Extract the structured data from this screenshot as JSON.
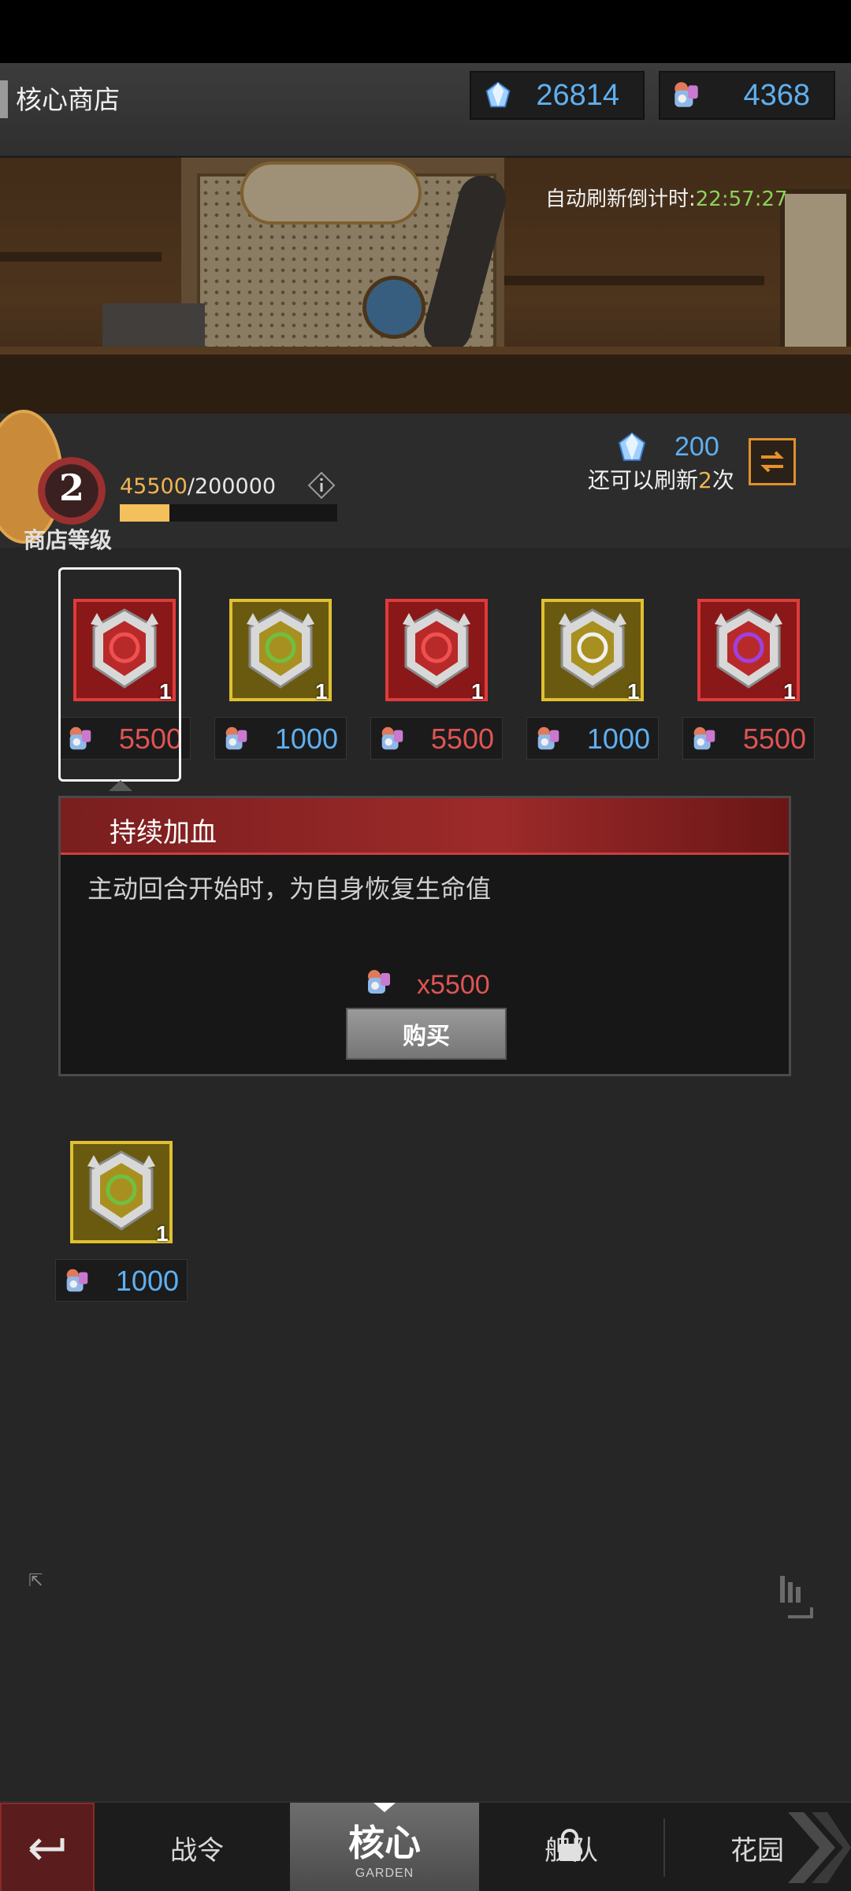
{
  "header": {
    "title": "核心商店",
    "gems": "26814",
    "crystals": "4368"
  },
  "banner": {
    "timer_label": "自动刷新倒计时:",
    "timer_value": "22:57:27"
  },
  "level": {
    "number": "2",
    "label": "商店等级",
    "exp_current": "45500",
    "exp_rest": "/200000",
    "exp_progress": 0.2275
  },
  "refresh": {
    "cost": "200",
    "prefix": "还可以刷新",
    "count": "2",
    "suffix": "次"
  },
  "items": [
    {
      "qty": "1",
      "price": "5500",
      "tier": "red",
      "icon": "heart-medal-icon"
    },
    {
      "qty": "1",
      "price": "1000",
      "tier": "gold",
      "icon": "sword-medal-icon"
    },
    {
      "qty": "1",
      "price": "5500",
      "tier": "red",
      "icon": "figure-medal-icon"
    },
    {
      "qty": "1",
      "price": "1000",
      "tier": "gold",
      "icon": "beast-medal-icon"
    },
    {
      "qty": "1",
      "price": "5500",
      "tier": "red",
      "icon": "purple-flame-medal-icon"
    },
    {
      "qty": "1",
      "price": "1000",
      "tier": "gold",
      "icon": "sword-medal-icon"
    }
  ],
  "detail": {
    "name": "持续加血",
    "description": "主动回合开始时，为自身恢复生命值",
    "cost": "x5500",
    "buy_label": "购买"
  },
  "nav": {
    "tab1": "战令",
    "tab2": "核心",
    "tab2_sub": "GARDEN",
    "tab3": "舰队",
    "tab4": "花园"
  },
  "colors": {
    "red_price": "#e05454",
    "blue_price": "#5fb0f0",
    "exp_fill": "#f3c05b",
    "timer_green": "#8bd35a"
  }
}
